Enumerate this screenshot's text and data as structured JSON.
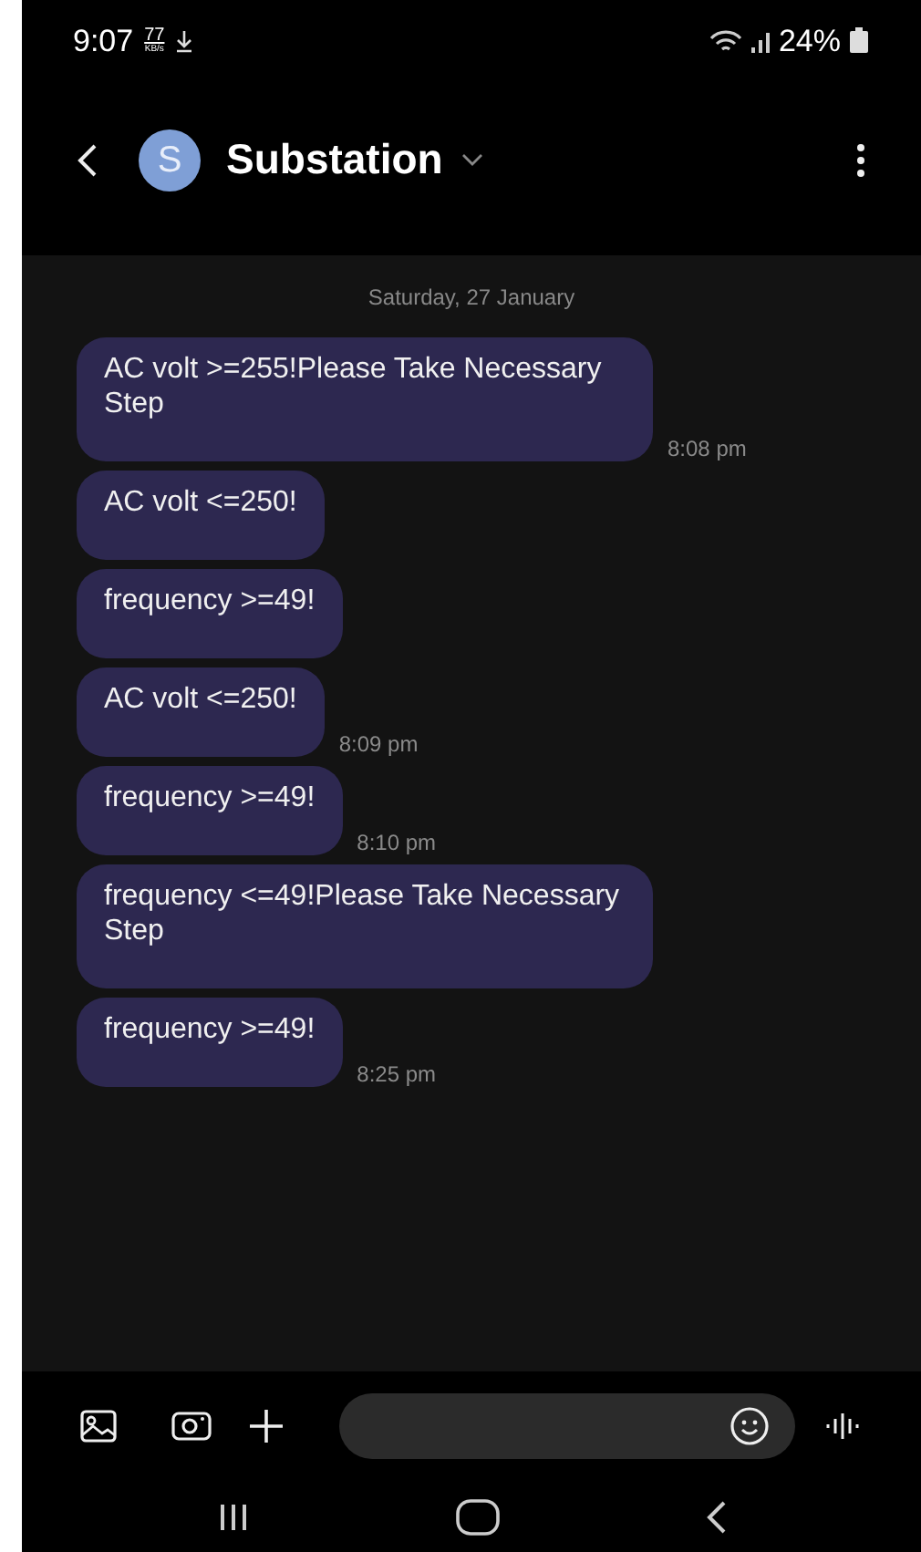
{
  "status_bar": {
    "time": "9:07",
    "speed_value": "77",
    "speed_unit": "KB/s",
    "battery": "24%"
  },
  "header": {
    "avatar_letter": "S",
    "title": "Substation"
  },
  "date_divider": "Saturday, 27 January",
  "messages": [
    {
      "text": "AC volt >=255!Please Take Necessary Step",
      "time": "8:08 pm"
    },
    {
      "text": "AC volt <=250!"
    },
    {
      "text": "frequency >=49!"
    },
    {
      "text": "AC volt <=250!",
      "time": "8:09 pm"
    },
    {
      "text": "frequency >=49!",
      "time": "8:10 pm"
    },
    {
      "text": "frequency <=49!Please Take Necessary Step"
    },
    {
      "text": "frequency >=49!",
      "time": "8:25 pm"
    }
  ]
}
